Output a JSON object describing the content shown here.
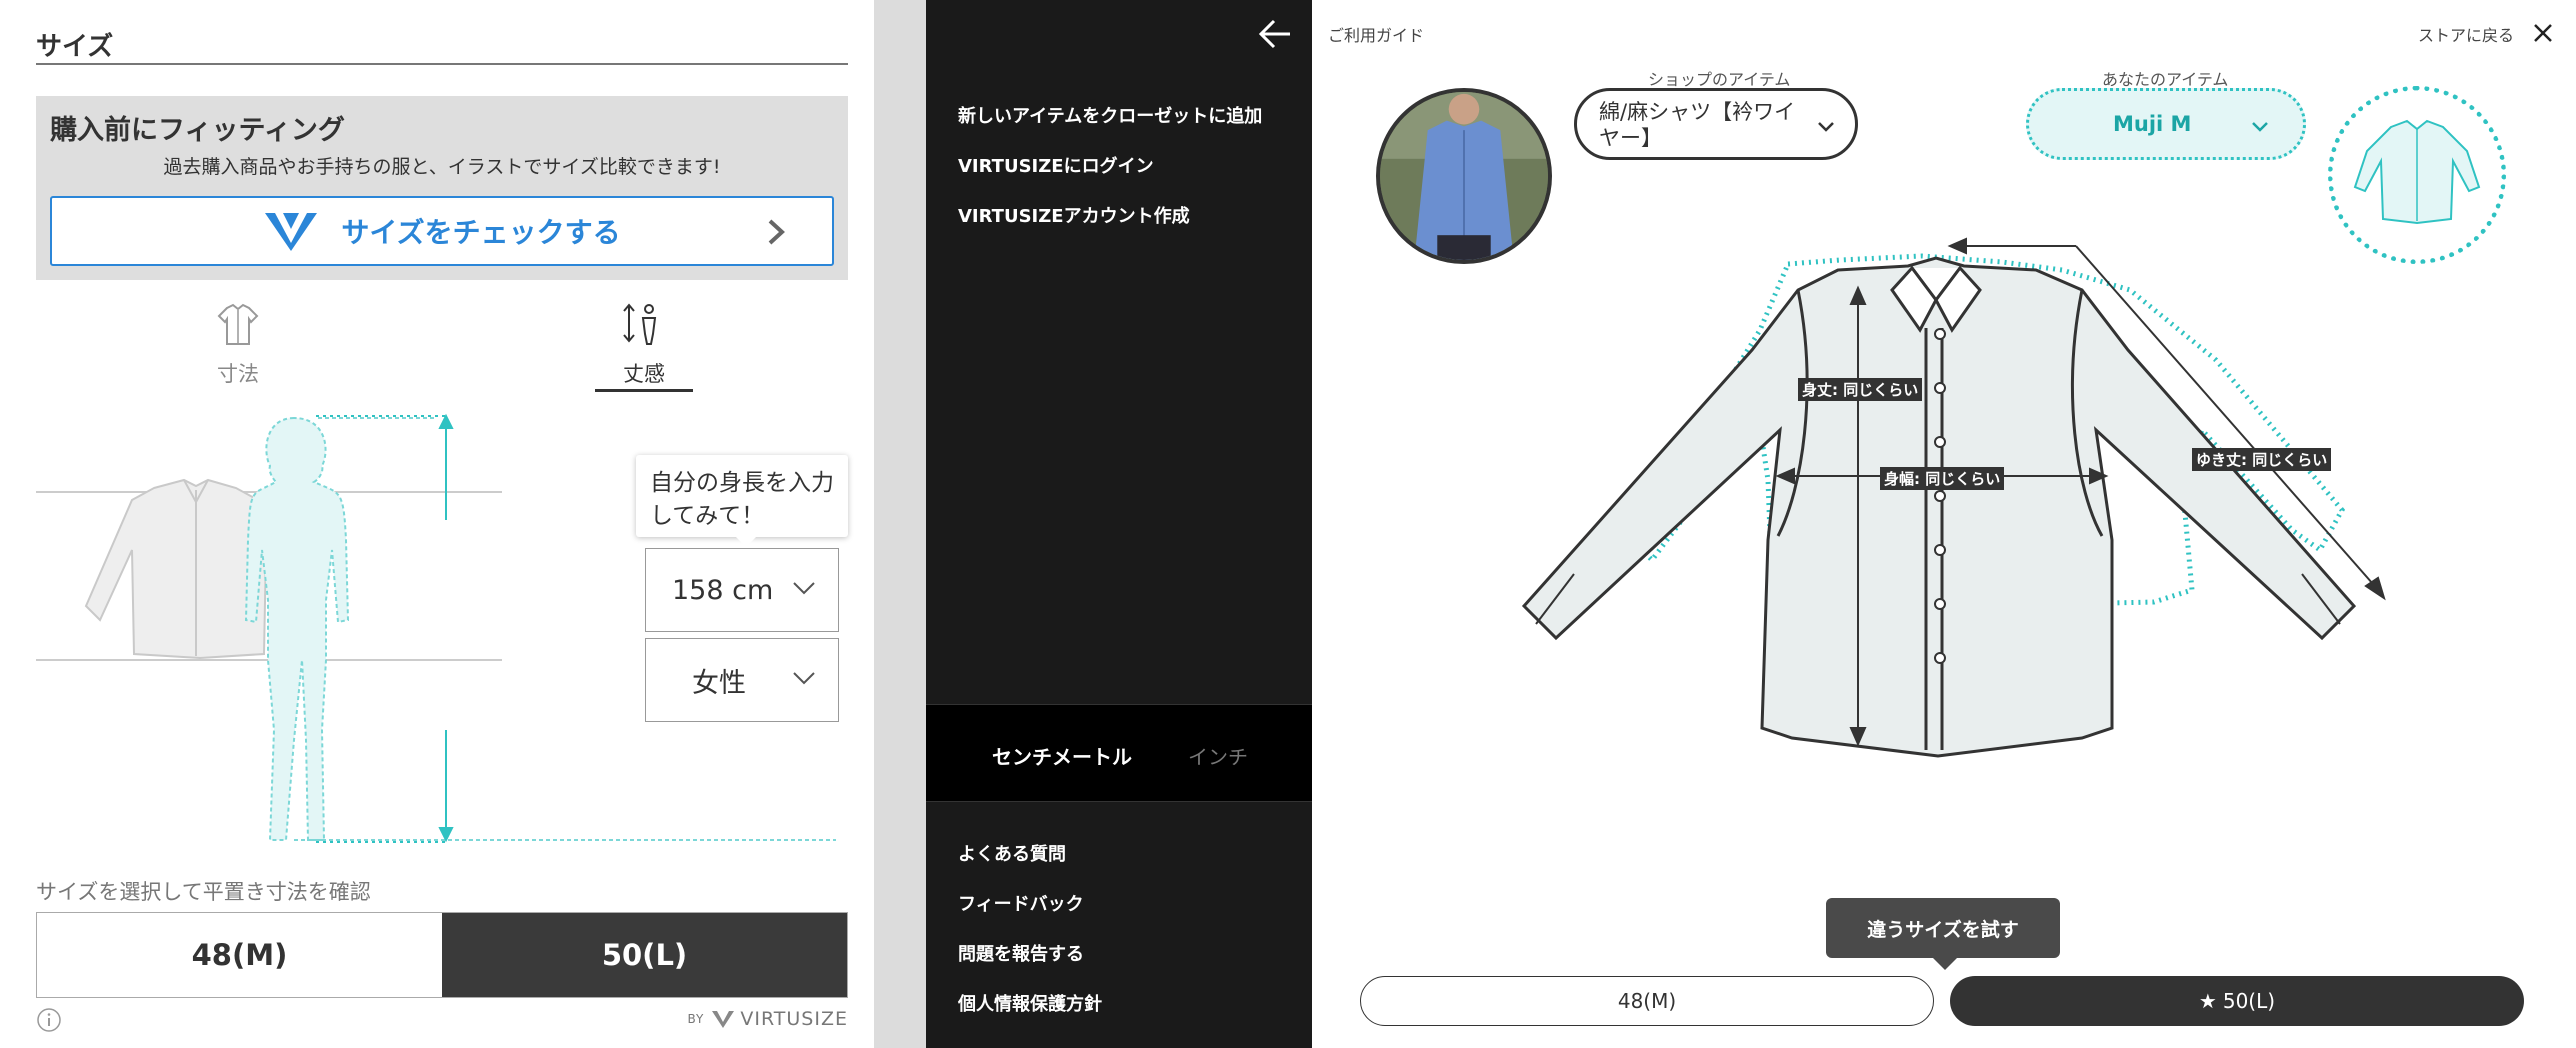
{
  "left_panel": {
    "section_title": "サイズ",
    "fitting": {
      "title": "購入前にフィッティング",
      "subtitle": "過去購入商品やお手持ちの服と、イラストでサイズ比較できます!",
      "check_button": "サイズをチェックする"
    },
    "tabs": [
      {
        "label": "寸法",
        "icon": "shirt-icon",
        "active": false
      },
      {
        "label": "丈感",
        "icon": "height-person-icon",
        "active": true
      }
    ],
    "tooltip": "自分の身長を入力してみて！",
    "height_select": "158 cm",
    "gender_select": "女性",
    "size_note": "サイズを選択して平置き寸法を確認",
    "sizes": [
      {
        "label": "48(M)",
        "selected": false
      },
      {
        "label": "50(L)",
        "selected": true
      }
    ],
    "footer": {
      "by": "BY",
      "brand": "VIRTUSIZE"
    }
  },
  "side_menu": {
    "items": [
      "新しいアイテムをクローゼットに追加",
      "VIRTUSIZEにログイン",
      "VIRTUSIZEアカウント作成"
    ],
    "units": {
      "active": "センチメートル",
      "inactive": "インチ"
    },
    "footer_items": [
      "よくある質問",
      "フィードバック",
      "問題を報告する",
      "個人情報保護方針"
    ]
  },
  "right_panel": {
    "guide": "ご利用ガイド",
    "store_back": "ストアに戻る",
    "shop_item": {
      "caption": "ショップのアイテム",
      "name": "綿/麻シャツ【衿ワイヤー】"
    },
    "your_item": {
      "caption": "あなたのアイテム",
      "name": "Muji M"
    },
    "measures": [
      {
        "label": "身丈: 同じくらい"
      },
      {
        "label": "身幅: 同じくらい"
      },
      {
        "label": "ゆき丈: 同じくらい"
      }
    ],
    "try_tip": "違うサイズを試す",
    "sizes": [
      {
        "label": "48(M)",
        "selected": false
      },
      {
        "label": "50(L)",
        "selected": true
      }
    ]
  },
  "colors": {
    "accent_blue": "#2b86d8",
    "teal": "#2fc2c2",
    "dark": "#1a1a1a"
  }
}
